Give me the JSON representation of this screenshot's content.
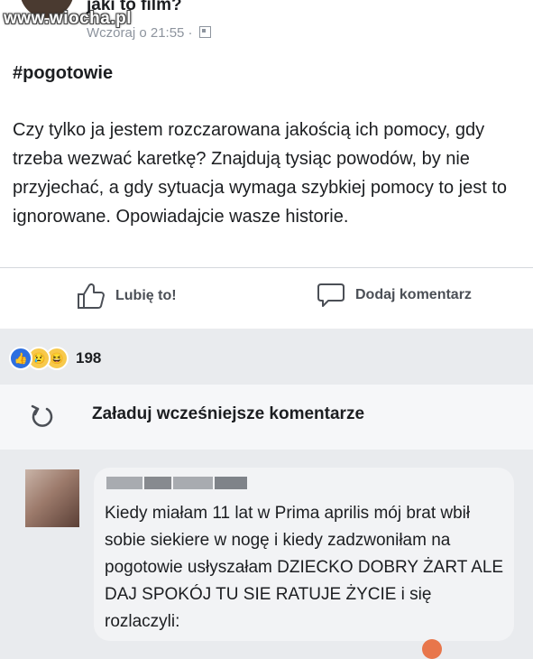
{
  "post": {
    "title": "jaki to film?",
    "timestamp": "Wczoraj o 21:55 ·",
    "hashtag": "#pogotowie",
    "body": "Czy tylko ja jestem rozczarowana jakością ich pomocy, gdy trzeba wezwać karetkę? Znajdują tysiąc powodów, by nie przyjechać, a gdy sytuacja wymaga szybkiej pomocy to jest to ignorowane. Opowiadajcie wasze historie."
  },
  "watermark": "www.wiocha.pl",
  "actions": {
    "like_label": "Lubię to!",
    "comment_label": "Dodaj komentarz"
  },
  "reactions": {
    "count": "198",
    "icons": [
      "like-icon",
      "sad-icon",
      "haha-icon"
    ]
  },
  "load_more": {
    "label": "Załaduj wcześniejsze komentarze"
  },
  "comment": {
    "text": "Kiedy miałam 11 lat w Prima aprilis mój brat wbił sobie siekiere w nogę i kiedy zadzwoniłam na pogotowie usłyszałam DZIECKO DOBRY ŻART ALE DAJ SPOKÓJ TU SIE RATUJE ŻYCIE  i się rozlaczyli:"
  },
  "colors": {
    "page_bg": "#e9ebee",
    "card_bg": "#ffffff",
    "muted": "#8d949e",
    "like_blue": "#2d6fe0",
    "emoji_yellow": "#f7c94b"
  }
}
